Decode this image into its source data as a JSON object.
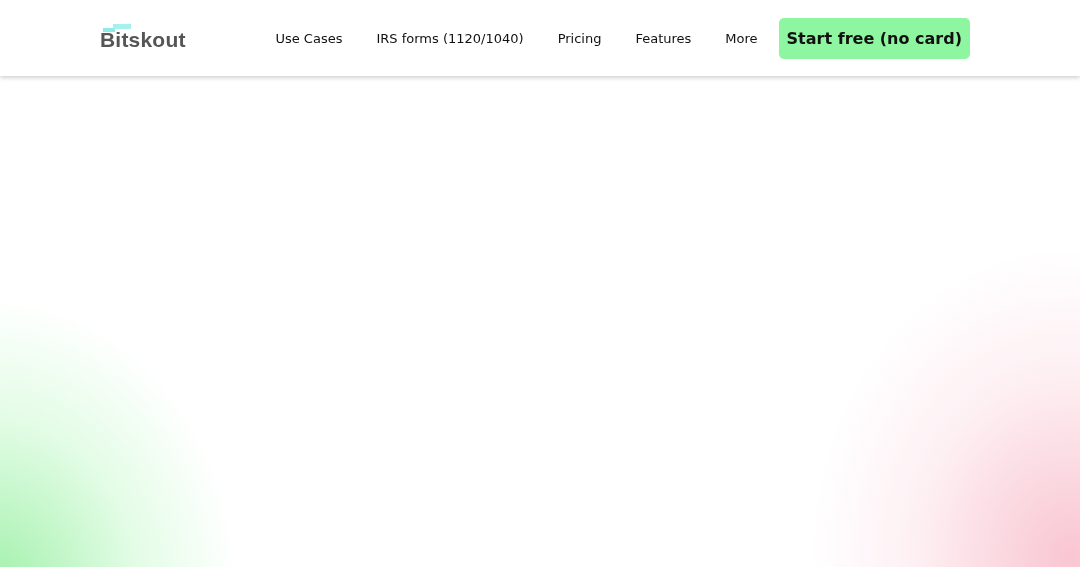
{
  "header": {
    "logo": "Bitskout",
    "nav": [
      "Use Cases",
      "IRS forms (1120/1040)",
      "Pricing",
      "Features",
      "More"
    ],
    "cta": "Start free (no card)"
  }
}
